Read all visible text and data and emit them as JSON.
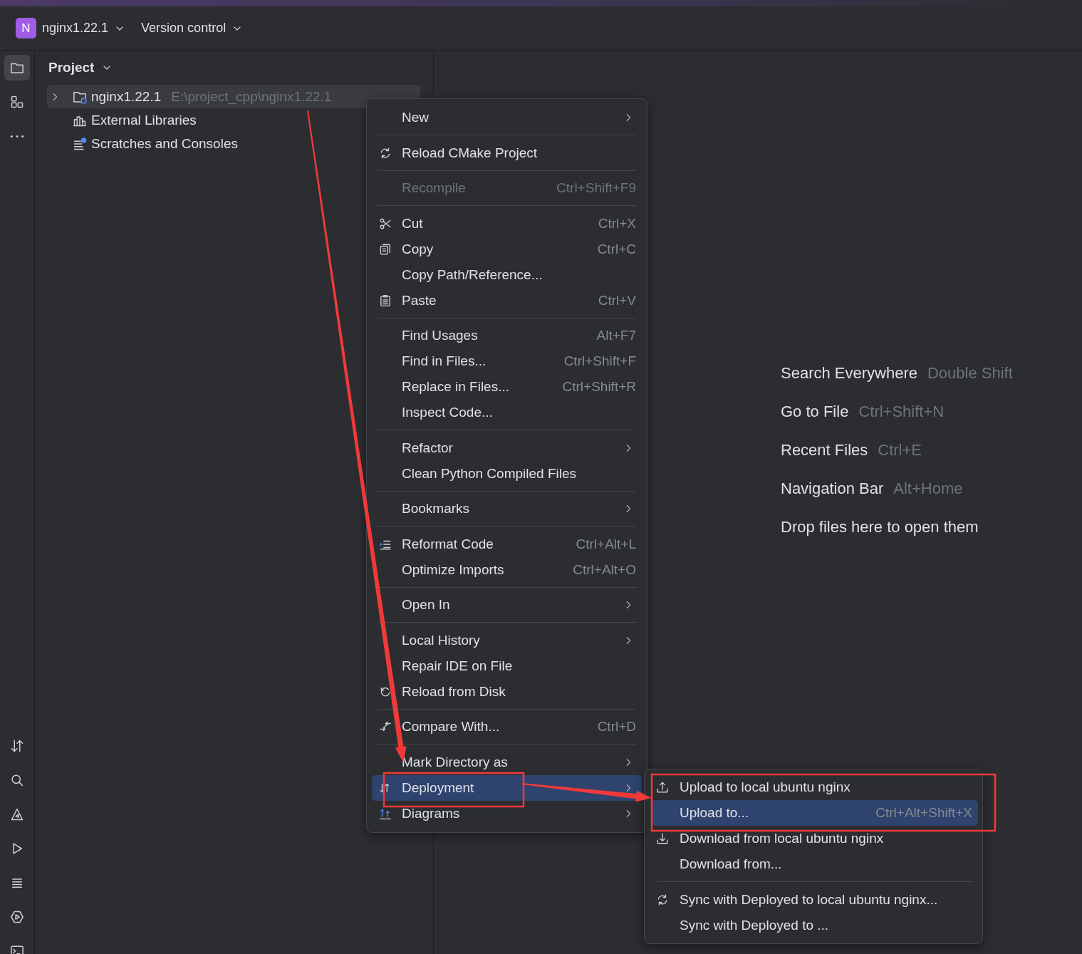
{
  "top_bar": {
    "project": {
      "badge": "N",
      "name": "nginx1.22.1"
    },
    "vcs": "Version control"
  },
  "left_toolbar": {
    "top": [
      {
        "selected": true
      },
      {
        "selected": false
      },
      {
        "selected": false
      }
    ],
    "bottom": [
      {
        "selected": false
      },
      {
        "selected": false
      },
      {
        "selected": false
      },
      {
        "selected": false
      },
      {
        "selected": false
      },
      {
        "selected": false
      },
      {
        "selected": false
      }
    ]
  },
  "project_panel": {
    "title": "Project",
    "tree": [
      {
        "label": "nginx1.22.1",
        "path": "E:\\project_cpp\\nginx1.22.1",
        "expanded": false,
        "selected": true
      },
      {
        "label": "External Libraries",
        "selected": false
      },
      {
        "label": "Scratches and Consoles",
        "selected": false
      }
    ]
  },
  "context_menu": {
    "groups": [
      [
        {
          "label": "New",
          "submenu": true,
          "disabled": false,
          "selected": false
        }
      ],
      [
        {
          "label": "Reload CMake Project",
          "submenu": false,
          "disabled": false,
          "selected": false
        }
      ],
      [
        {
          "label": "Recompile",
          "shortcut": "Ctrl+Shift+F9",
          "submenu": false,
          "disabled": true,
          "selected": false
        }
      ],
      [
        {
          "label": "Cut",
          "shortcut": "Ctrl+X",
          "submenu": false,
          "disabled": false,
          "selected": false
        },
        {
          "label": "Copy",
          "shortcut": "Ctrl+C",
          "submenu": false,
          "disabled": false,
          "selected": false
        },
        {
          "label": "Copy Path/Reference...",
          "submenu": false,
          "disabled": false,
          "selected": false
        },
        {
          "label": "Paste",
          "shortcut": "Ctrl+V",
          "submenu": false,
          "disabled": false,
          "selected": false
        }
      ],
      [
        {
          "label": "Find Usages",
          "shortcut": "Alt+F7",
          "submenu": false,
          "disabled": false,
          "selected": false
        },
        {
          "label": "Find in Files...",
          "shortcut": "Ctrl+Shift+F",
          "submenu": false,
          "disabled": false,
          "selected": false
        },
        {
          "label": "Replace in Files...",
          "shortcut": "Ctrl+Shift+R",
          "submenu": false,
          "disabled": false,
          "selected": false
        },
        {
          "label": "Inspect Code...",
          "submenu": false,
          "disabled": false,
          "selected": false
        }
      ],
      [
        {
          "label": "Refactor",
          "submenu": true,
          "disabled": false,
          "selected": false
        },
        {
          "label": "Clean Python Compiled Files",
          "submenu": false,
          "disabled": false,
          "selected": false
        }
      ],
      [
        {
          "label": "Bookmarks",
          "submenu": true,
          "disabled": false,
          "selected": false
        }
      ],
      [
        {
          "label": "Reformat Code",
          "shortcut": "Ctrl+Alt+L",
          "submenu": false,
          "disabled": false,
          "selected": false
        },
        {
          "label": "Optimize Imports",
          "shortcut": "Ctrl+Alt+O",
          "submenu": false,
          "disabled": false,
          "selected": false
        }
      ],
      [
        {
          "label": "Open In",
          "submenu": true,
          "disabled": false,
          "selected": false
        }
      ],
      [
        {
          "label": "Local History",
          "submenu": true,
          "disabled": false,
          "selected": false
        },
        {
          "label": "Repair IDE on File",
          "submenu": false,
          "disabled": false,
          "selected": false
        },
        {
          "label": "Reload from Disk",
          "submenu": false,
          "disabled": false,
          "selected": false
        }
      ],
      [
        {
          "label": "Compare With...",
          "shortcut": "Ctrl+D",
          "submenu": false,
          "disabled": false,
          "selected": false
        }
      ],
      [
        {
          "label": "Mark Directory as",
          "submenu": true,
          "disabled": false,
          "selected": false
        },
        {
          "label": "Deployment",
          "submenu": true,
          "disabled": false,
          "selected": true
        },
        {
          "label": "Diagrams",
          "submenu": true,
          "disabled": false,
          "selected": false
        }
      ]
    ]
  },
  "submenu": {
    "groups": [
      [
        {
          "label": "Upload to local ubuntu nginx",
          "submenu": false,
          "disabled": false,
          "selected": false
        },
        {
          "label": "Upload to...",
          "shortcut": "Ctrl+Alt+Shift+X",
          "submenu": false,
          "disabled": false,
          "selected": true
        },
        {
          "label": "Download from local ubuntu nginx",
          "submenu": false,
          "disabled": false,
          "selected": false
        },
        {
          "label": "Download from...",
          "submenu": false,
          "disabled": false,
          "selected": false
        }
      ],
      [
        {
          "label": "Sync with Deployed to local ubuntu nginx...",
          "submenu": false,
          "disabled": false,
          "selected": false
        },
        {
          "label": "Sync with Deployed to ...",
          "submenu": false,
          "disabled": false,
          "selected": false
        }
      ]
    ]
  },
  "hints": [
    {
      "action": "Search Everywhere",
      "shortcut": "Double Shift"
    },
    {
      "action": "Go to File",
      "shortcut": "Ctrl+Shift+N"
    },
    {
      "action": "Recent Files",
      "shortcut": "Ctrl+E"
    },
    {
      "action": "Navigation Bar",
      "shortcut": "Alt+Home"
    },
    {
      "action": "Drop files here to open them"
    }
  ],
  "annotations": [
    {
      "kind": "arrow"
    },
    {
      "kind": "rectangle"
    },
    {
      "kind": "arrow"
    },
    {
      "kind": "rectangle"
    }
  ]
}
